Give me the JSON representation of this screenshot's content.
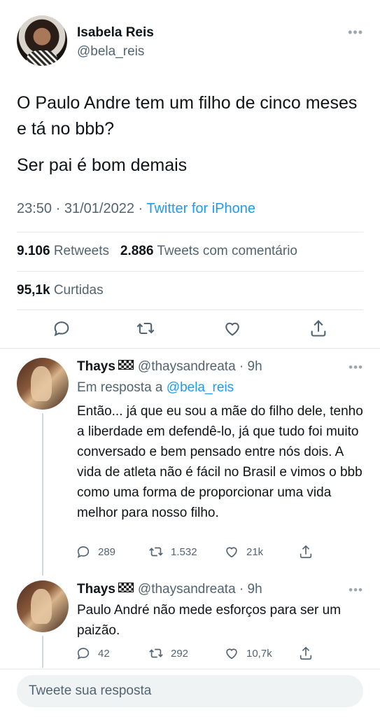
{
  "tweet": {
    "author_name": "Isabela Reis",
    "author_handle": "@bela_reis",
    "more_icon": "more-icon",
    "text_line1": "O Paulo Andre tem um filho de cinco meses e tá no bbb?",
    "text_line2": "Ser pai é bom demais",
    "time": "23:50",
    "date": "31/01/2022",
    "source": "Twitter for iPhone",
    "retweets": "9.106",
    "retweets_label": "Retweets",
    "quotes": "2.886",
    "quotes_label": "Tweets com comentário",
    "likes": "95,1k",
    "likes_label": "Curtidas",
    "actions": [
      "reply-icon",
      "retweet-icon",
      "like-icon",
      "share-icon"
    ]
  },
  "replies": [
    {
      "name": "Thays",
      "handle_time": "@thaysandreata · 9h",
      "in_reply_label": "Em resposta a",
      "in_reply_mention": "@bela_reis",
      "text": "Então... já que eu sou a mãe do filho dele, tenho a liberdade em defendê-lo, já que tudo foi muito conversado e bem pensado entre nós dois. A vida de atleta não é fácil no Brasil e vimos o bbb como uma forma de proporcionar uma vida melhor para nosso filho.",
      "replies": "289",
      "retweets": "1.532",
      "likes": "21k"
    },
    {
      "name": "Thays",
      "handle_time": "@thaysandreata · 9h",
      "text": "Paulo André não mede esforços para ser um paizão.",
      "replies": "42",
      "retweets": "292",
      "likes": "10,7k"
    }
  ],
  "composer": {
    "placeholder": "Tweete sua resposta"
  },
  "colors": {
    "accent": "#1d9bf0",
    "secondary_text": "#536471",
    "divider": "#e6e9eb"
  }
}
